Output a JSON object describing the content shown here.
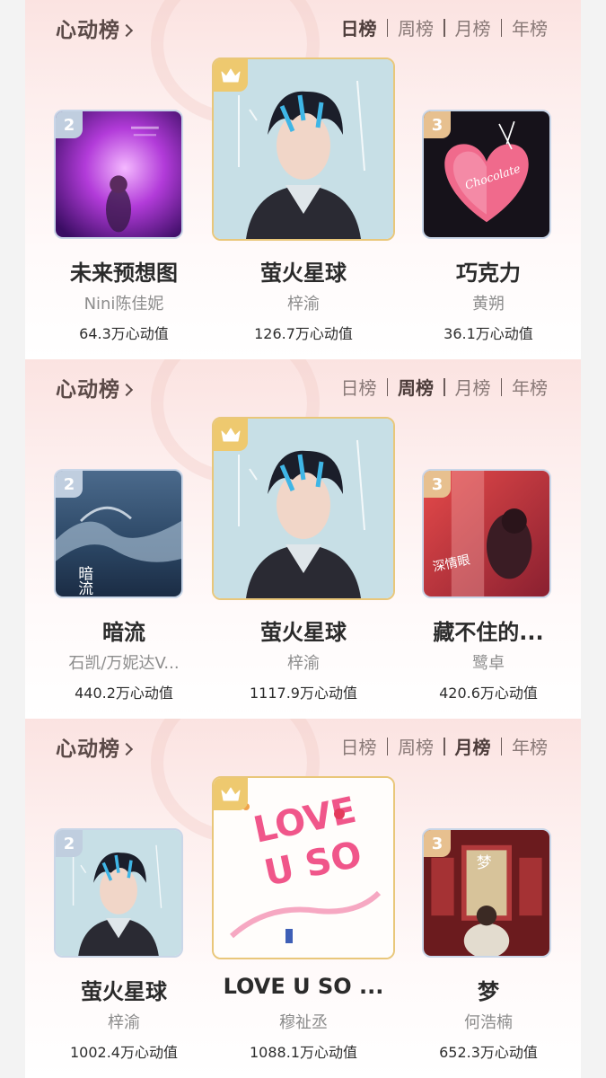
{
  "boards": [
    {
      "title": "心动榜",
      "tabs": [
        "日榜",
        "周榜",
        "月榜",
        "年榜"
      ],
      "active_tab": "日榜",
      "entries": [
        {
          "rank": "2",
          "title": "未来预想图",
          "artist": "Nini陈佳妮",
          "value": "64.3万心动值",
          "art": "purple-neon"
        },
        {
          "rank": "crown",
          "title": "萤火星球",
          "artist": "梓渝",
          "value": "126.7万心动值",
          "art": "portrait-blue"
        },
        {
          "rank": "3",
          "title": "巧克力",
          "artist": "黄朔",
          "value": "36.1万心动值",
          "art": "chocolate-heart"
        }
      ]
    },
    {
      "title": "心动榜",
      "tabs": [
        "日榜",
        "周榜",
        "月榜",
        "年榜"
      ],
      "active_tab": "周榜",
      "entries": [
        {
          "rank": "2",
          "title": "暗流",
          "artist": "石凯/万妮达V...",
          "value": "440.2万心动值",
          "art": "ocean-wave"
        },
        {
          "rank": "crown",
          "title": "萤火星球",
          "artist": "梓渝",
          "value": "1117.9万心动值",
          "art": "portrait-blue"
        },
        {
          "rank": "3",
          "title": "藏不住的...",
          "artist": "鹭卓",
          "value": "420.6万心动值",
          "art": "red-couple"
        }
      ]
    },
    {
      "title": "心动榜",
      "tabs": [
        "日榜",
        "周榜",
        "月榜",
        "年榜"
      ],
      "active_tab": "月榜",
      "entries": [
        {
          "rank": "2",
          "title": "萤火星球",
          "artist": "梓渝",
          "value": "1002.4万心动值",
          "art": "portrait-blue"
        },
        {
          "rank": "crown",
          "title": "LOVE U SO ...",
          "artist": "穆祉丞",
          "value": "1088.1万心动值",
          "art": "love-u-so"
        },
        {
          "rank": "3",
          "title": "梦",
          "artist": "何浩楠",
          "value": "652.3万心动值",
          "art": "dream-doors"
        }
      ]
    }
  ],
  "colors": {
    "silver_badge": "#c0cedf",
    "bronze_badge": "#e7c08f",
    "gold_badge": "#eec96f",
    "title_text": "#5b4a48"
  }
}
